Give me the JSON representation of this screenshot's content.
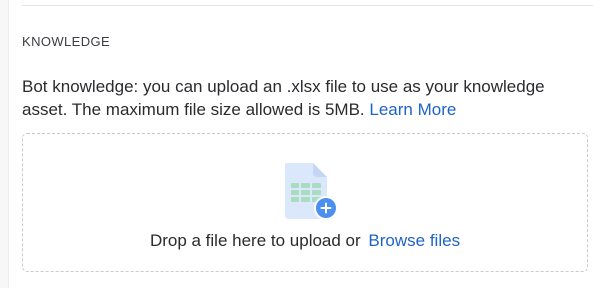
{
  "section": {
    "title": "KNOWLEDGE",
    "description": "Bot knowledge: you can upload an .xlsx file to use as your knowledge asset. The maximum file size allowed is 5MB.",
    "learn_more_label": "Learn More"
  },
  "dropzone": {
    "prompt": "Drop a file here to upload or",
    "browse_label": "Browse files",
    "icon": "spreadsheet-upload-icon"
  },
  "colors": {
    "link": "#1f63c9",
    "file_icon": "#dbe7fb",
    "sheet_grid": "#a9dcc0",
    "plus_badge": "#4b8ff0"
  }
}
